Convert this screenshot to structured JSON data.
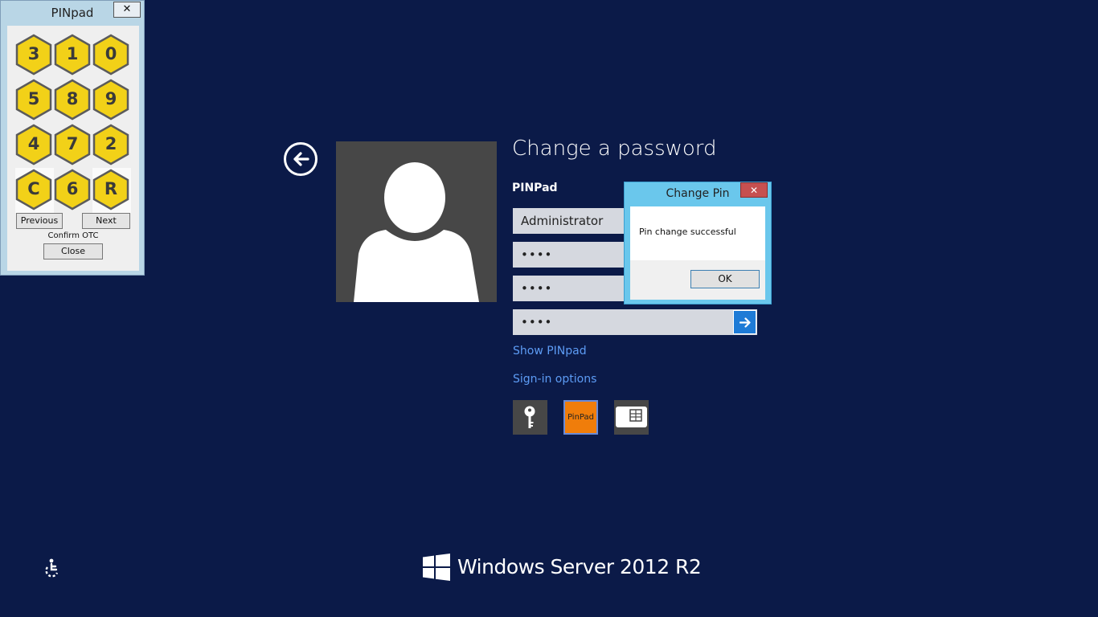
{
  "pinpad_window": {
    "title": "PINpad",
    "close_glyph": "✕",
    "keys": [
      "3",
      "1",
      "0",
      "5",
      "8",
      "9",
      "4",
      "7",
      "2",
      "C",
      "6",
      "R"
    ],
    "previous_label": "Previous",
    "next_label": "Next",
    "confirm_label": "Confirm OTC",
    "close_label": "Close",
    "key_color": "#f2d118"
  },
  "logon": {
    "title": "Change a password",
    "provider": "PINPad",
    "username_value": "Administrator",
    "old_pin_value": "••••",
    "new_pin_value": "••••",
    "confirm_pin_value": "••••",
    "show_pinpad_link": "Show PINpad",
    "sign_in_options_link": "Sign-in options",
    "sign_in_tiles": [
      {
        "icon": "key-icon"
      },
      {
        "label": "PinPad",
        "color": "#f07d0a"
      },
      {
        "icon": "smart-card-icon"
      }
    ]
  },
  "dialog": {
    "title": "Change Pin",
    "close_glyph": "✕",
    "message": "Pin change successful",
    "ok_label": "OK"
  },
  "footer": {
    "brand_text": "Windows Server 2012 R2"
  },
  "colors": {
    "background": "#0b1a48",
    "link": "#5d9cf5",
    "accent": "#1e7bd6"
  }
}
